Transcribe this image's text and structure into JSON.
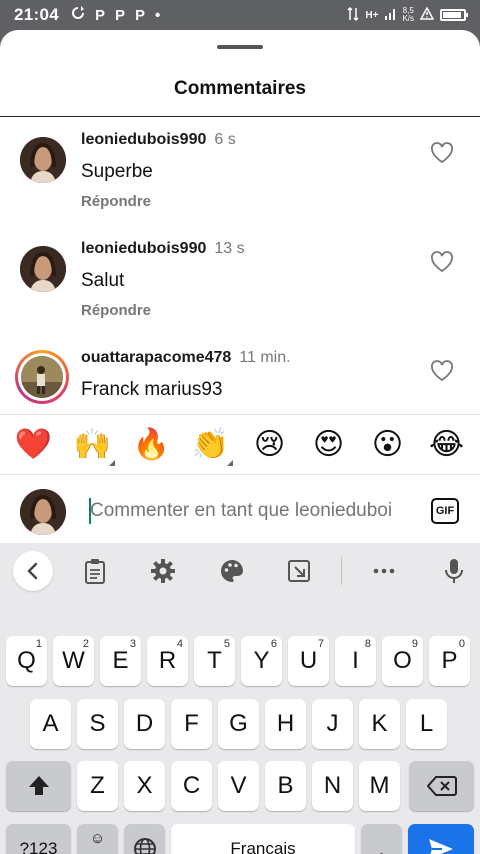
{
  "status_bar": {
    "time": "21:04",
    "notif_icons": [
      "sync-icon",
      "p-icon",
      "p-icon",
      "p-icon",
      "dot-icon"
    ],
    "notif_letters": [
      "P",
      "P",
      "P"
    ],
    "network": "H+",
    "speed_value": "8,5",
    "speed_unit": "K/s",
    "battery_level": 0.9
  },
  "sheet": {
    "title": "Commentaires"
  },
  "comments": [
    {
      "username": "leoniedubois990",
      "time": "6 s",
      "text": "Superbe",
      "reply_label": "Répondre"
    },
    {
      "username": "leoniedubois990",
      "time": "13 s",
      "text": "Salut",
      "reply_label": "Répondre"
    },
    {
      "username": "ouattarapacome478",
      "time": "11 min.",
      "text": "Franck marius93",
      "reply_label": ""
    }
  ],
  "emoji_bar": [
    "❤️",
    "🙌",
    "🔥",
    "👏",
    "😢",
    "😍",
    "😮",
    "😂"
  ],
  "composer": {
    "placeholder": "Commenter en tant que leonieduboi",
    "gif_label": "GIF"
  },
  "keyboard": {
    "row1": [
      {
        "k": "Q",
        "h": "1"
      },
      {
        "k": "W",
        "h": "2"
      },
      {
        "k": "E",
        "h": "3"
      },
      {
        "k": "R",
        "h": "4"
      },
      {
        "k": "T",
        "h": "5"
      },
      {
        "k": "Y",
        "h": "6"
      },
      {
        "k": "U",
        "h": "7"
      },
      {
        "k": "I",
        "h": "8"
      },
      {
        "k": "O",
        "h": "9"
      },
      {
        "k": "P",
        "h": "0"
      }
    ],
    "row2": [
      "A",
      "S",
      "D",
      "F",
      "G",
      "H",
      "J",
      "K",
      "L"
    ],
    "row3": [
      "Z",
      "X",
      "C",
      "V",
      "B",
      "N",
      "M"
    ],
    "numbers_label": "?123",
    "comma_label": ",",
    "space_label": "Français",
    "period_label": ".",
    "accent_color": "#1a73e8"
  }
}
